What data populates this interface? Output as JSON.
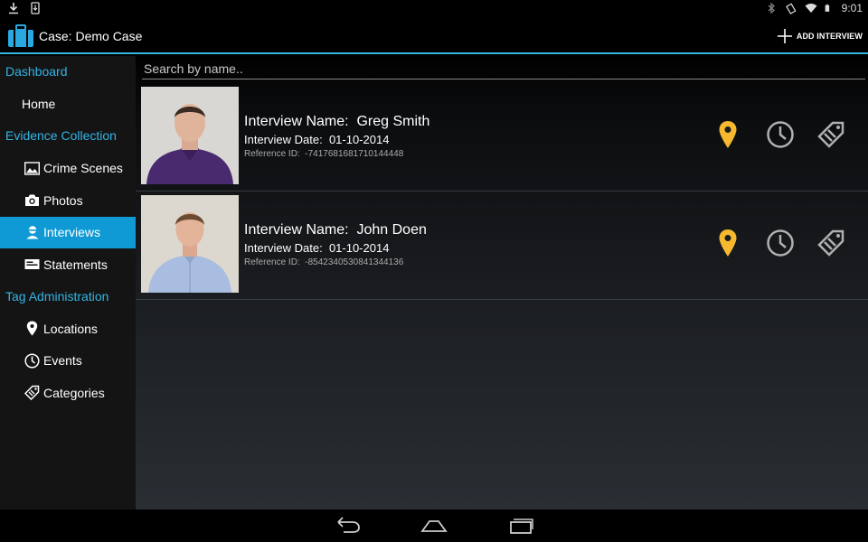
{
  "status_bar": {
    "time": "9:01",
    "left_icons": [
      "download-icon",
      "screenshot-icon"
    ],
    "right_icons": [
      "bluetooth-icon",
      "rotate-icon",
      "wifi-icon",
      "battery-icon"
    ]
  },
  "action_bar": {
    "title": "Case: Demo Case",
    "add_label": "ADD INTERVIEW",
    "accent_color": "#33b5e5"
  },
  "sidebar": {
    "sections": [
      {
        "header": "Dashboard",
        "items": [
          {
            "label": "Home",
            "icon": ""
          }
        ]
      },
      {
        "header": "Evidence Collection",
        "items": [
          {
            "label": "Crime Scenes",
            "icon": "image-icon"
          },
          {
            "label": "Photos",
            "icon": "camera-icon"
          },
          {
            "label": "Interviews",
            "icon": "person-icon",
            "active": true
          },
          {
            "label": "Statements",
            "icon": "statement-icon"
          }
        ]
      },
      {
        "header": "Tag Administration",
        "items": [
          {
            "label": "Locations",
            "icon": "pin-icon"
          },
          {
            "label": "Events",
            "icon": "clock-icon"
          },
          {
            "label": "Categories",
            "icon": "tag-icon"
          }
        ]
      }
    ],
    "active_color": "#0f9ad5"
  },
  "search": {
    "placeholder": "Search by name..",
    "value": ""
  },
  "interviews": [
    {
      "name_label": "Interview Name:",
      "name": "Greg Smith",
      "date_label": "Interview Date:",
      "date": "01-10-2014",
      "ref_label": "Reference ID:",
      "ref": "-7417681681710144448",
      "shirt_color": "#4a2a6e"
    },
    {
      "name_label": "Interview Name:",
      "name": "John Doen",
      "date_label": "Interview Date:",
      "date": "01-10-2014",
      "ref_label": "Reference ID:",
      "ref": "-8542340530841344136",
      "shirt_color": "#a9bde0"
    }
  ],
  "row_actions": {
    "pin_color": "#f5b82e",
    "icon_color": "#b0b0b0"
  }
}
